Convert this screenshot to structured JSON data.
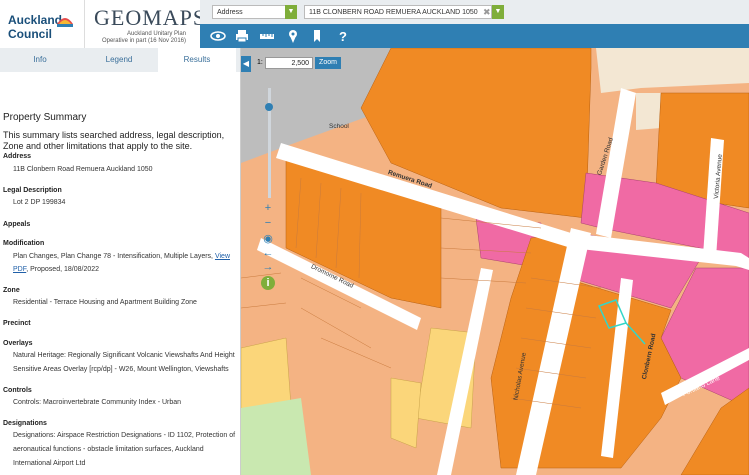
{
  "header": {
    "logo_line1": "Auckland",
    "logo_line2": "Council",
    "app_title": "GEOMAPS",
    "plan_line1": "Auckland Unitary Plan",
    "plan_line2": "Operative in part (16 Nov 2016)"
  },
  "search": {
    "type_value": "Address",
    "address_value": "11B CLONBERN ROAD REMUERA AUCKLAND 1050",
    "clear_glyph": "✖",
    "dropdown_glyph": "▼"
  },
  "toolbar": {
    "icons": [
      "eye-icon",
      "print-icon",
      "measure-icon",
      "pin-icon",
      "bookmark-icon",
      "help-icon"
    ],
    "glyphs": [
      "👁",
      "🖶",
      "▭",
      "⚲",
      "▮",
      "?"
    ]
  },
  "tabs": [
    "Info",
    "Legend",
    "Results"
  ],
  "summary": {
    "title": "Property Summary",
    "intro": "This summary lists searched address, legal description, Zone and other limitations that apply to the site.",
    "address_label": "Address",
    "address_value": "11B Clonbern Road Remuera Auckland 1050",
    "legal_label": "Legal Description",
    "legal_value": "Lot 2 DP 199834",
    "appeals_label": "Appeals",
    "modification_label": "Modification",
    "modification_value_a": "Plan Changes, Plan Change 78 - Intensification, Multiple Layers, ",
    "modification_link": "View PDF",
    "modification_value_b": ", Proposed, 18/08/2022",
    "zone_label": "Zone",
    "zone_value": "Residential - Terrace Housing and Apartment Building Zone",
    "precinct_label": "Precinct",
    "overlays_label": "Overlays",
    "overlays_value": "Natural Heritage: Regionally Significant Volcanic Viewshafts And Height Sensitive Areas Overlay [rcp/dp] - W26, Mount Wellington, Viewshafts",
    "controls_label": "Controls",
    "controls_value": "Controls: Macroinvertebrate Community Index - Urban",
    "designations_label": "Designations",
    "designations_value": "Designations: Airspace Restriction Designations - ID 1102, Protection of aeronautical functions - obstacle limitation surfaces, Auckland International Airport Ltd"
  },
  "map": {
    "scale_prefix": "1:",
    "scale_value": "2,500",
    "zoom_label": "Zoom",
    "collapse_glyph": "◀",
    "labels": {
      "school": "School",
      "remuera_road": "Remuera Road",
      "garden_road": "Garden Road",
      "victoria_avenue": "Victoria Avenue",
      "dromorne_road": "Dromorne Road",
      "nicholas_avenue": "Nicholas Avenue",
      "clonbern_road": "Clonbern Road",
      "portland_lane": "Portland Lane"
    },
    "controls": [
      "+",
      "−",
      "◉",
      "←",
      "→",
      "i"
    ]
  },
  "colors": {
    "brand_blue": "#2f7fb3",
    "orange_zone": "#f08a24",
    "light_orange_zone": "#f4b383",
    "pink_zone": "#f06aa4",
    "yellow_zone": "#fbd67a",
    "park_green": "#c9e8b0",
    "highlight_parcel": "#33d6c8"
  }
}
